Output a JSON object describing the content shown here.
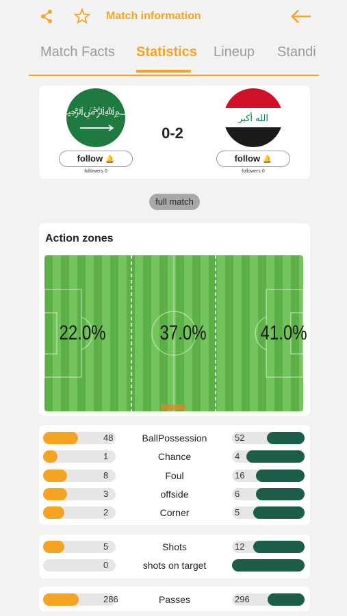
{
  "header": {
    "title": "Match information"
  },
  "tabs": [
    "Match Facts",
    "Statistics",
    "Lineup",
    "Standings"
  ],
  "tab_visible": [
    "Match Facts",
    "Statistics",
    "Lineup",
    "Standi"
  ],
  "match": {
    "home": {
      "follow_label": "follow",
      "followers_label": "followers 0"
    },
    "away": {
      "follow_label": "follow",
      "followers_label": "followers 0"
    },
    "score": "0-2"
  },
  "period_chip": "full match",
  "action_zones": {
    "title": "Action zones",
    "left": "22.0%",
    "middle": "37.0%",
    "right": "41.0%"
  },
  "stats_group1": [
    {
      "label": "BallPossession",
      "home": "48",
      "away": "52",
      "home_frac": 0.48,
      "away_frac": 0.52
    },
    {
      "label": "Chance",
      "home": "1",
      "away": "4",
      "home_frac": 0.2,
      "away_frac": 0.8
    },
    {
      "label": "Foul",
      "home": "8",
      "away": "16",
      "home_frac": 0.33,
      "away_frac": 0.67
    },
    {
      "label": "offside",
      "home": "3",
      "away": "6",
      "home_frac": 0.33,
      "away_frac": 0.67
    },
    {
      "label": "Corner",
      "home": "2",
      "away": "5",
      "home_frac": 0.29,
      "away_frac": 0.71
    }
  ],
  "stats_group2": [
    {
      "label": "Shots",
      "home": "5",
      "away": "12",
      "home_frac": 0.29,
      "away_frac": 0.71
    },
    {
      "label": "shots on target",
      "home": "0",
      "away": "",
      "home_frac": 0.0,
      "away_frac": 1.0
    }
  ],
  "stats_group3": [
    {
      "label": "Passes",
      "home": "286",
      "away": "296",
      "home_frac": 0.49,
      "away_frac": 0.51
    }
  ],
  "colors": {
    "accent": "#f4a422",
    "away_bar": "#1b5e45"
  }
}
